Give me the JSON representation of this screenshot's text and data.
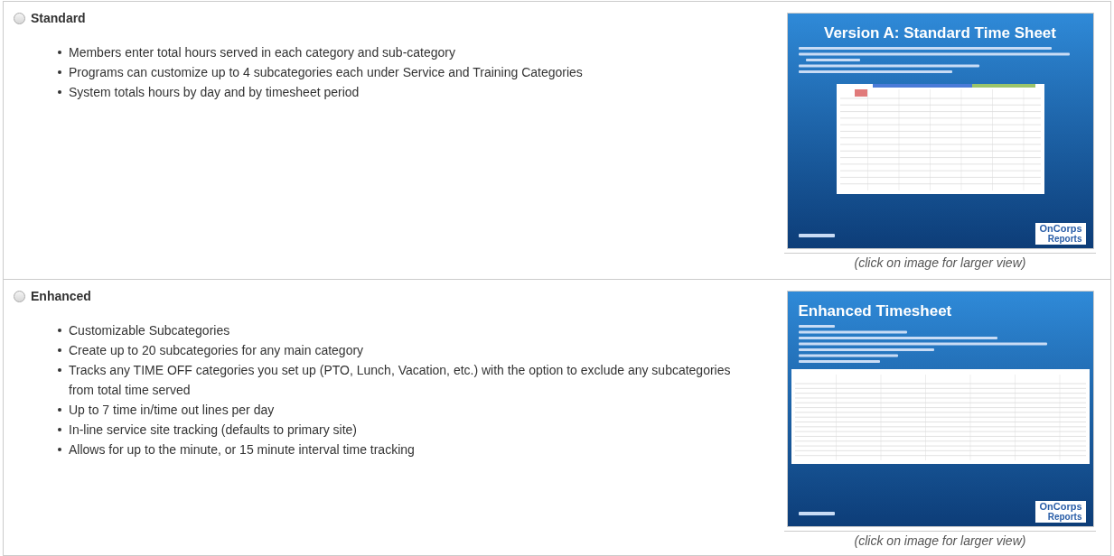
{
  "options": [
    {
      "label": "Standard",
      "selected": false,
      "bullets": [
        "Members enter total hours served in each category and sub-category",
        "Programs can customize up to 4 subcategories each under Service and Training Categories",
        "System totals hours by day and by timesheet period"
      ],
      "slide": {
        "kind": "standard",
        "title": "Version A: Standard Time Sheet",
        "logo": [
          "OnCorps",
          "Reports"
        ]
      },
      "caption": "(click on image for larger view)"
    },
    {
      "label": "Enhanced",
      "selected": false,
      "bullets": [
        "Customizable Subcategories",
        "Create up to 20 subcategories for any main category",
        "Tracks any TIME OFF categories you set up (PTO, Lunch, Vacation, etc.) with the option to exclude any subcategories from total time served",
        "Up to 7 time in/time out lines per day",
        "In-line service site tracking (defaults to primary site)",
        "Allows for up to the minute, or 15 minute interval time tracking"
      ],
      "slide": {
        "kind": "enhanced",
        "title": "Enhanced Timesheet",
        "logo": [
          "OnCorps",
          "Reports"
        ]
      },
      "caption": "(click on image for larger view)"
    }
  ]
}
